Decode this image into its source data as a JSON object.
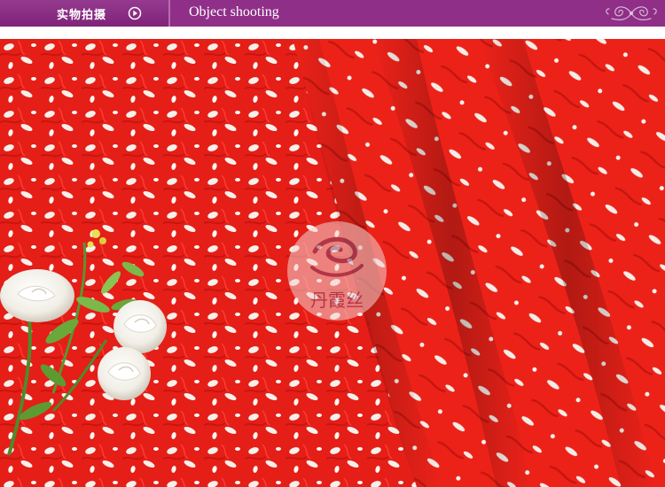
{
  "header": {
    "title_zh": "实物拍摄",
    "title_en": "Object shooting",
    "play_icon": "play-circle-icon",
    "ornament_icon": "swirl-ornament-icon",
    "bar_color": "#8f2f88"
  },
  "photo": {
    "subject": "red-lace-fabric",
    "fabric_color": "#e8201a",
    "watermark_logo_text": "丹霞丝"
  }
}
